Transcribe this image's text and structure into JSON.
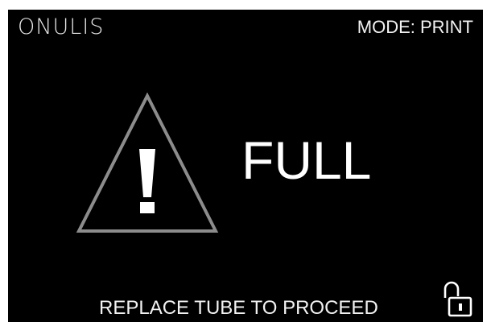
{
  "header": {
    "brand": "ONULIS",
    "mode": "MODE: PRINT"
  },
  "alert": {
    "icon": "warning-triangle-icon",
    "status": "FULL",
    "instruction": "REPLACE TUBE TO PROCEED"
  },
  "controls": {
    "lock_icon": "unlocked-padlock-icon"
  },
  "colors": {
    "background": "#000000",
    "text": "#ffffff",
    "warning_outline": "#8c8c8c"
  }
}
